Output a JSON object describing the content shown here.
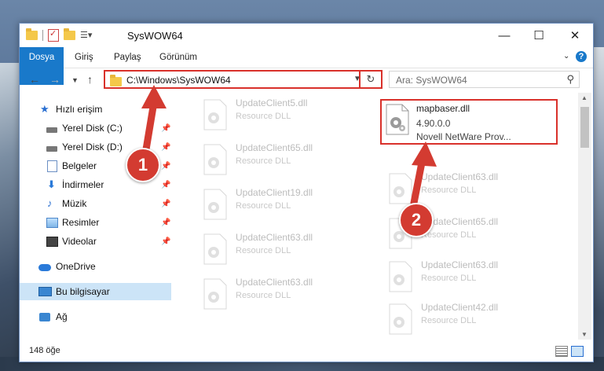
{
  "window": {
    "title": "SysWOW64",
    "minimize": "—",
    "maximize": "☐",
    "close": "✕"
  },
  "ribbon": {
    "tabs": [
      "Dosya",
      "Giriş",
      "Paylaş",
      "Görünüm"
    ],
    "help": "?"
  },
  "address": {
    "path": "C:\\Windows\\SysWOW64",
    "search_placeholder": "Ara: SysWOW64"
  },
  "sidebar": {
    "items": [
      {
        "label": "Hızlı erişim",
        "icon": "star-icon"
      },
      {
        "label": "Yerel Disk (C:)",
        "icon": "drive-icon",
        "pinned": true
      },
      {
        "label": "Yerel Disk (D:)",
        "icon": "drive-icon",
        "pinned": true
      },
      {
        "label": "Belgeler",
        "icon": "documents-icon",
        "pinned": true
      },
      {
        "label": "İndirmeler",
        "icon": "downloads-icon",
        "pinned": true
      },
      {
        "label": "Müzik",
        "icon": "music-icon",
        "pinned": true
      },
      {
        "label": "Resimler",
        "icon": "pictures-icon",
        "pinned": true
      },
      {
        "label": "Videolar",
        "icon": "videos-icon",
        "pinned": true
      },
      {
        "label": "OneDrive",
        "icon": "onedrive-icon"
      },
      {
        "label": "Bu bilgisayar",
        "icon": "this-pc-icon",
        "selected": true
      },
      {
        "label": "Ağ",
        "icon": "network-icon"
      }
    ]
  },
  "files": {
    "left_column": [
      {
        "name": "UpdateClient5.dll",
        "desc": "Resource DLL"
      },
      {
        "name": "UpdateClient65.dll",
        "desc": "Resource DLL"
      },
      {
        "name": "UpdateClient19.dll",
        "desc": "Resource DLL"
      },
      {
        "name": "UpdateClient63.dll",
        "desc": "Resource DLL"
      },
      {
        "name": "UpdateClient63.dll",
        "desc": "Resource DLL"
      }
    ],
    "right_column": [
      {
        "name": "UpdateClient63.dll",
        "desc": "Resource DLL"
      },
      {
        "name": "UpdateClient65.dll",
        "desc": "Resource DLL"
      },
      {
        "name": "UpdateClient63.dll",
        "desc": "Resource DLL"
      },
      {
        "name": "UpdateClient42.dll",
        "desc": "Resource DLL"
      }
    ],
    "highlighted": {
      "name": "mapbaser.dll",
      "version": "4.90.0.0",
      "company": "Novell NetWare Prov..."
    }
  },
  "status": {
    "count": "148 öğe"
  },
  "callouts": [
    "1",
    "2"
  ],
  "colors": {
    "accent": "#1979ca",
    "highlight": "#d9312b"
  }
}
